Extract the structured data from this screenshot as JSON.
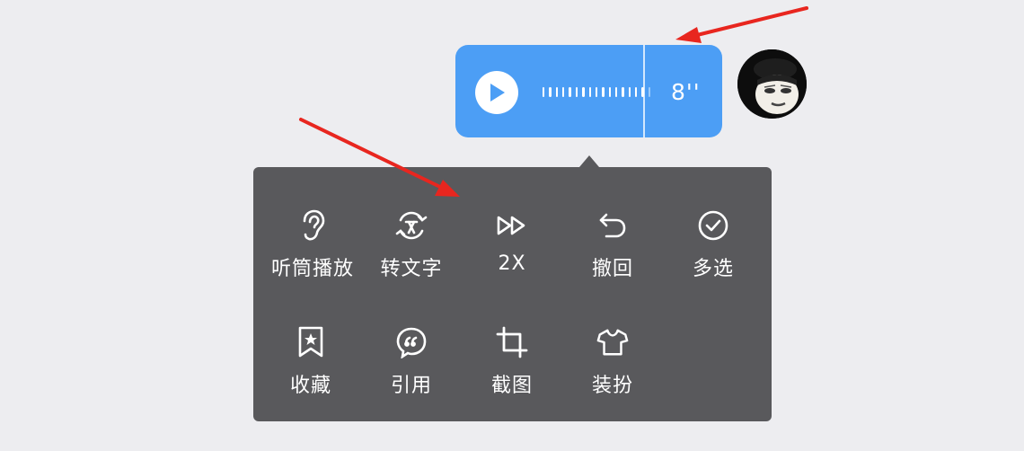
{
  "voice_message": {
    "duration": "8''"
  },
  "context_menu": {
    "row1": [
      {
        "label": "听筒播放",
        "icon": "ear-icon"
      },
      {
        "label": "转文字",
        "icon": "transcribe-icon"
      },
      {
        "label": "2X",
        "icon": "fast-forward-icon"
      },
      {
        "label": "撤回",
        "icon": "undo-icon"
      },
      {
        "label": "多选",
        "icon": "check-circle-icon"
      }
    ],
    "row2": [
      {
        "label": "收藏",
        "icon": "bookmark-star-icon"
      },
      {
        "label": "引用",
        "icon": "quote-icon"
      },
      {
        "label": "截图",
        "icon": "crop-icon"
      },
      {
        "label": "装扮",
        "icon": "tshirt-icon"
      }
    ]
  },
  "colors": {
    "bubble": "#4c9ef5",
    "menu_bg": "#59595c",
    "background": "#ededf0",
    "annotation_arrow": "#e8261f"
  }
}
